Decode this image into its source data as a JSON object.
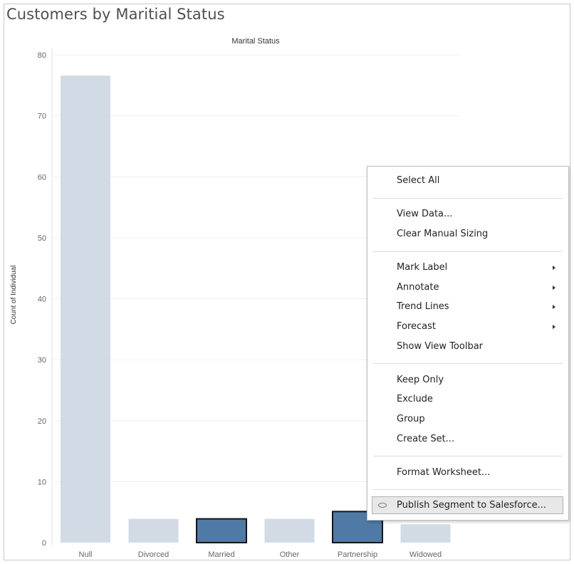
{
  "title": "Customers by Maritial Status",
  "chart_data": {
    "type": "bar",
    "column_header": "Marital Status",
    "ylabel": "Count of Individual",
    "ylim": [
      0,
      80
    ],
    "yticks": [
      "0",
      "10",
      "20",
      "30",
      "40",
      "50",
      "60",
      "70",
      "80"
    ],
    "categories": [
      "Null",
      "Divorced",
      "Married",
      "Other",
      "Partnership",
      "Widowed"
    ],
    "values": [
      76.6,
      3.9,
      3.9,
      3.9,
      5.1,
      3.0
    ],
    "selected": [
      false,
      false,
      true,
      false,
      true,
      false
    ],
    "colors": {
      "bar": "#d2dbe5",
      "selected_bar": "#5079a5",
      "selected_border": "#141414"
    },
    "grid": true
  },
  "context_menu": {
    "select_all": "Select All",
    "view_data": "View Data...",
    "clear_manual_sizing": "Clear Manual Sizing",
    "mark_label": "Mark Label",
    "annotate": "Annotate",
    "trend_lines": "Trend Lines",
    "forecast": "Forecast",
    "show_view_toolbar": "Show View Toolbar",
    "keep_only": "Keep Only",
    "exclude": "Exclude",
    "group": "Group",
    "create_set": "Create Set...",
    "format_worksheet": "Format Worksheet...",
    "publish_segment": "Publish Segment to Salesforce...",
    "publish_icon": "salesforce-cloud-icon",
    "submenu_icon": "submenu-arrow-icon"
  }
}
